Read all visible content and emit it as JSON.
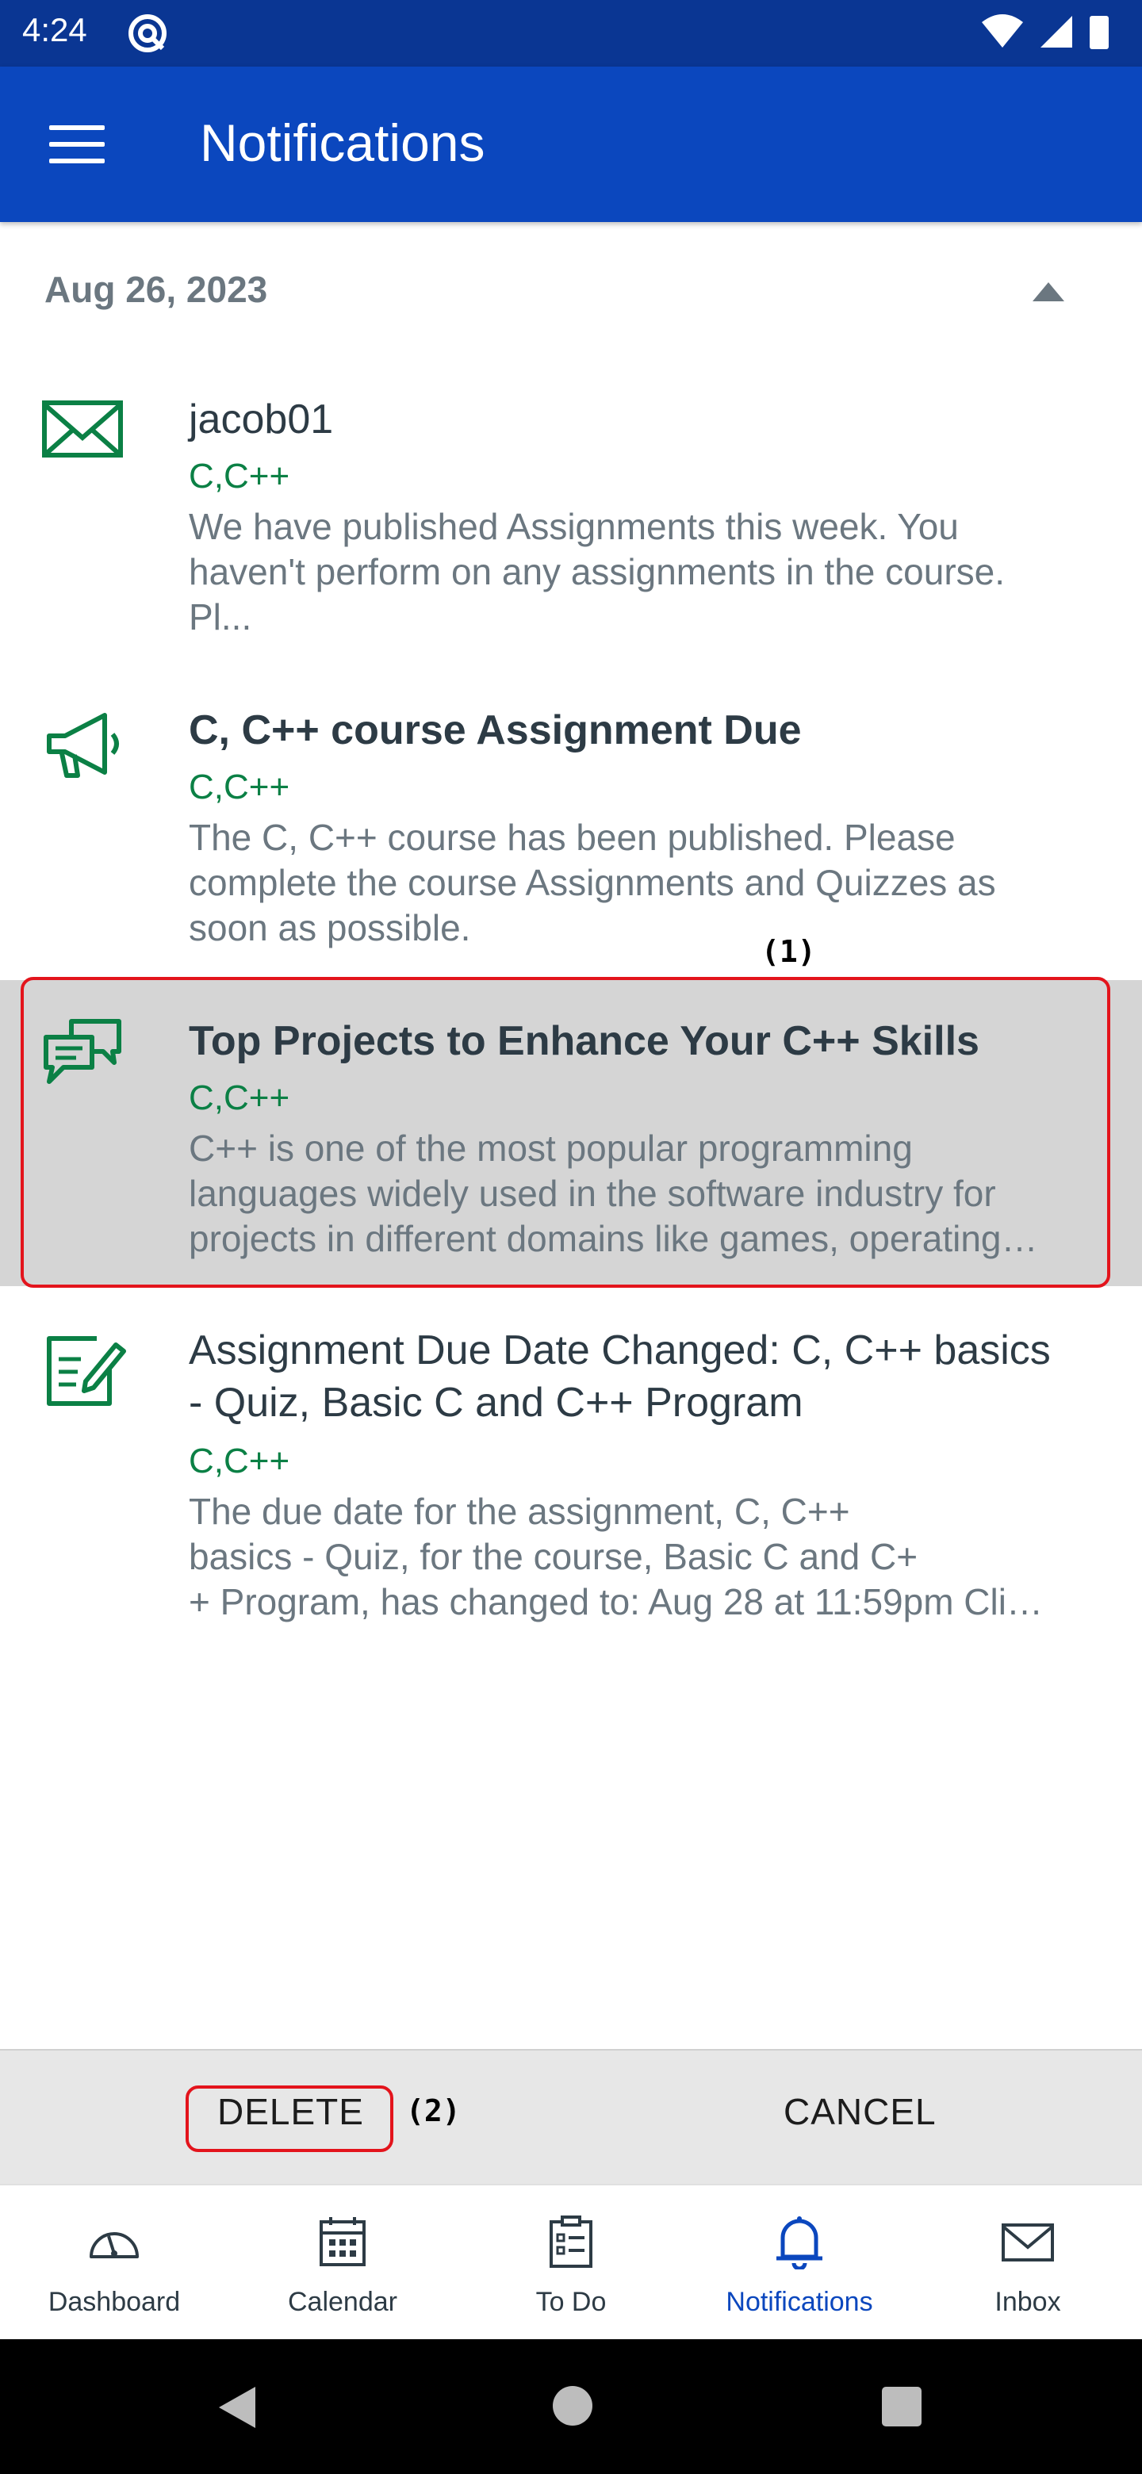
{
  "status_bar": {
    "time": "4:24"
  },
  "app_bar": {
    "title": "Notifications",
    "menu_icon": "hamburger-menu-icon"
  },
  "date_group": {
    "date": "Aug 26, 2023",
    "toggle_icon": "triangle-up-icon"
  },
  "notifications": [
    {
      "icon": "envelope-icon",
      "title": "jacob01",
      "course": "C,C++",
      "body_lines": [
        "We have published Assignments this week. You",
        "haven't perform on any assignments in the course.",
        "Pl..."
      ]
    },
    {
      "icon": "megaphone-icon",
      "title": "C, C++ course Assignment Due",
      "course": "C,C++",
      "body_lines": [
        "The C, C++ course has been published. Please",
        "complete the course Assignments and Quizzes as",
        "soon as possible."
      ]
    },
    {
      "icon": "discussion-icon",
      "title": "Top Projects to Enhance Your C++ Skills",
      "course": "C,C++",
      "body_lines": [
        "C++ is one of the most popular programming",
        "languages widely used in the software industry for",
        "projects in different domains like games, operating…"
      ]
    },
    {
      "icon": "assignment-edit-icon",
      "title_lines": [
        "Assignment Due Date Changed: C, C++ basics",
        "- Quiz, Basic C and C++ Program"
      ],
      "course": "C,C++",
      "body_lines": [
        "The due date for the assignment, C, C++",
        "basics - Quiz, for the course, Basic C and C+",
        "+ Program, has changed to: Aug 28 at 11:59pm Cli…"
      ]
    }
  ],
  "annotations": {
    "selected_item": "(1)",
    "delete_button": "(2)"
  },
  "actions": {
    "delete_label": "DELETE",
    "cancel_label": "CANCEL"
  },
  "bottom_nav": [
    {
      "label": "Dashboard",
      "icon": "dashboard-gauge-icon"
    },
    {
      "label": "Calendar",
      "icon": "calendar-icon"
    },
    {
      "label": "To Do",
      "icon": "clipboard-icon"
    },
    {
      "label": "Notifications",
      "icon": "bell-icon",
      "active": true
    },
    {
      "label": "Inbox",
      "icon": "envelope-icon"
    }
  ],
  "colors": {
    "status_bar": "#0a3693",
    "app_bar": "#0b47be",
    "course_green": "#0b8045",
    "active_nav": "#0b47be",
    "highlight_outline": "#e3141c"
  }
}
